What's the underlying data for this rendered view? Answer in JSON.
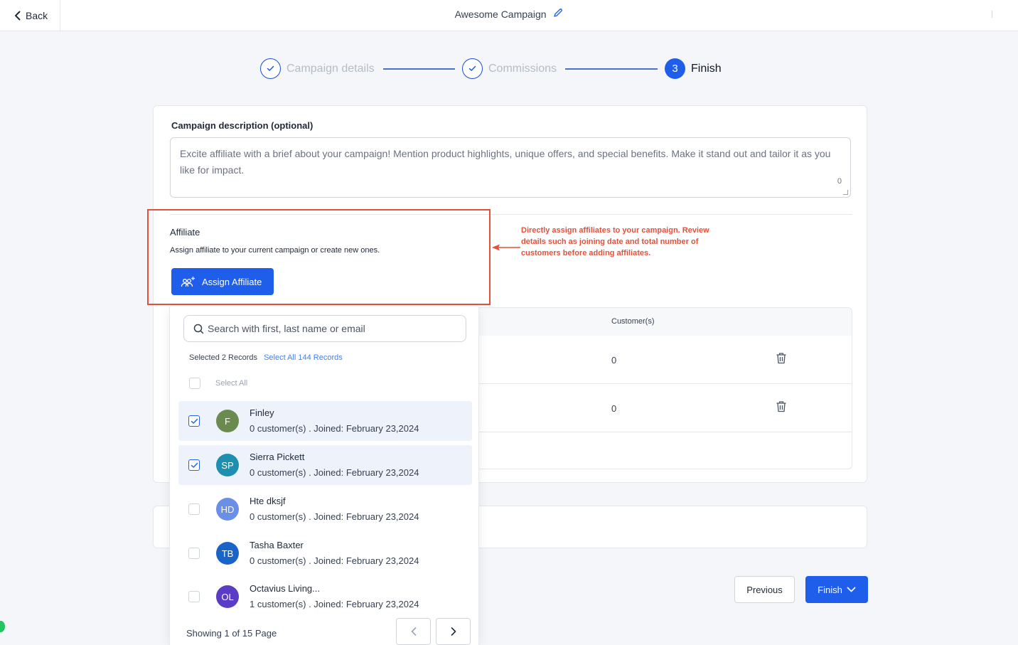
{
  "topbar": {
    "back_label": "Back",
    "title": "Awesome Campaign"
  },
  "stepper": {
    "steps": [
      {
        "label": "Campaign details",
        "state": "done"
      },
      {
        "label": "Commissions",
        "state": "done"
      },
      {
        "label": "Finish",
        "state": "active",
        "number": "3"
      }
    ]
  },
  "description": {
    "label": "Campaign description (optional)",
    "placeholder": "Excite affiliate with a brief about your campaign! Mention product highlights, unique offers, and special benefits. Make it stand out and tailor it as you like for impact.",
    "char_count": "0"
  },
  "affiliate": {
    "title": "Affiliate",
    "subtitle": "Assign affiliate to your current campaign or create new ones.",
    "assign_button": "Assign Affiliate"
  },
  "annotation": {
    "text": "Directly assign affiliates to your campaign. Review details such as joining date and total number of customers before adding affiliates."
  },
  "table": {
    "customers_header": "Customer(s)",
    "rows": [
      {
        "customers": "0"
      },
      {
        "customers": "0"
      }
    ]
  },
  "dropdown": {
    "search_placeholder": "Search with first, last name or email",
    "selected_text": "Selected 2 Records",
    "select_all_records": "Select All 144 Records",
    "select_all_label": "Select All",
    "items": [
      {
        "initials": "F",
        "name": "Finley",
        "meta": "0 customer(s) . Joined: February 23,2024",
        "checked": true,
        "color": "#6b8a4f"
      },
      {
        "initials": "SP",
        "name": "Sierra Pickett",
        "meta": "0 customer(s) . Joined: February 23,2024",
        "checked": true,
        "color": "#1f8fb0"
      },
      {
        "initials": "HD",
        "name": "Hte dksjf",
        "meta": "0 customer(s) . Joined: February 23,2024",
        "checked": false,
        "color": "#6b8ee6"
      },
      {
        "initials": "TB",
        "name": "Tasha Baxter",
        "meta": "0 customer(s) . Joined: February 23,2024",
        "checked": false,
        "color": "#1a64c8"
      },
      {
        "initials": "OL",
        "name": "Octavius Living...",
        "meta": "1 customer(s) . Joined: February 23,2024",
        "checked": false,
        "color": "#5b3cc4"
      }
    ],
    "pager_text": "Showing 1 of 15 Page"
  },
  "footer": {
    "previous": "Previous",
    "finish": "Finish"
  },
  "colors": {
    "primary": "#1e5eeb",
    "annotation": "#e4503a"
  }
}
